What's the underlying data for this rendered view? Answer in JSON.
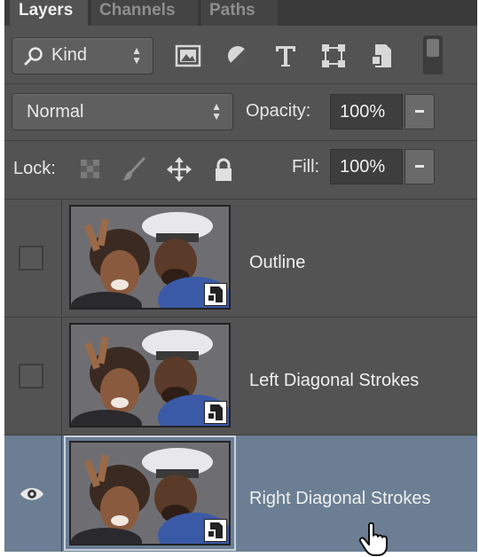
{
  "tabs": [
    {
      "label": "Layers",
      "active": true
    },
    {
      "label": "Channels",
      "active": false
    },
    {
      "label": "Paths",
      "active": false
    }
  ],
  "filter": {
    "kind_label": "Kind",
    "icons": [
      "image-filter-icon",
      "adjustment-filter-icon",
      "type-filter-icon",
      "shape-filter-icon",
      "smart-object-filter-icon"
    ]
  },
  "blend": {
    "mode": "Normal",
    "opacity_label": "Opacity:",
    "opacity_value": "100%"
  },
  "lock": {
    "label": "Lock:",
    "icons": [
      "lock-transparent-pixels-icon",
      "lock-image-pixels-icon",
      "lock-position-icon",
      "lock-all-icon"
    ],
    "fill_label": "Fill:",
    "fill_value": "100%"
  },
  "layers": [
    {
      "name": "Outline",
      "visible": false,
      "selected": false
    },
    {
      "name": "Left Diagonal Strokes",
      "visible": false,
      "selected": false
    },
    {
      "name": "Right Diagonal Strokes",
      "visible": true,
      "selected": true
    }
  ],
  "colors": {
    "panel_bg": "#535353",
    "selected_bg": "#6b7e93",
    "input_bg": "#3e3e3e"
  }
}
